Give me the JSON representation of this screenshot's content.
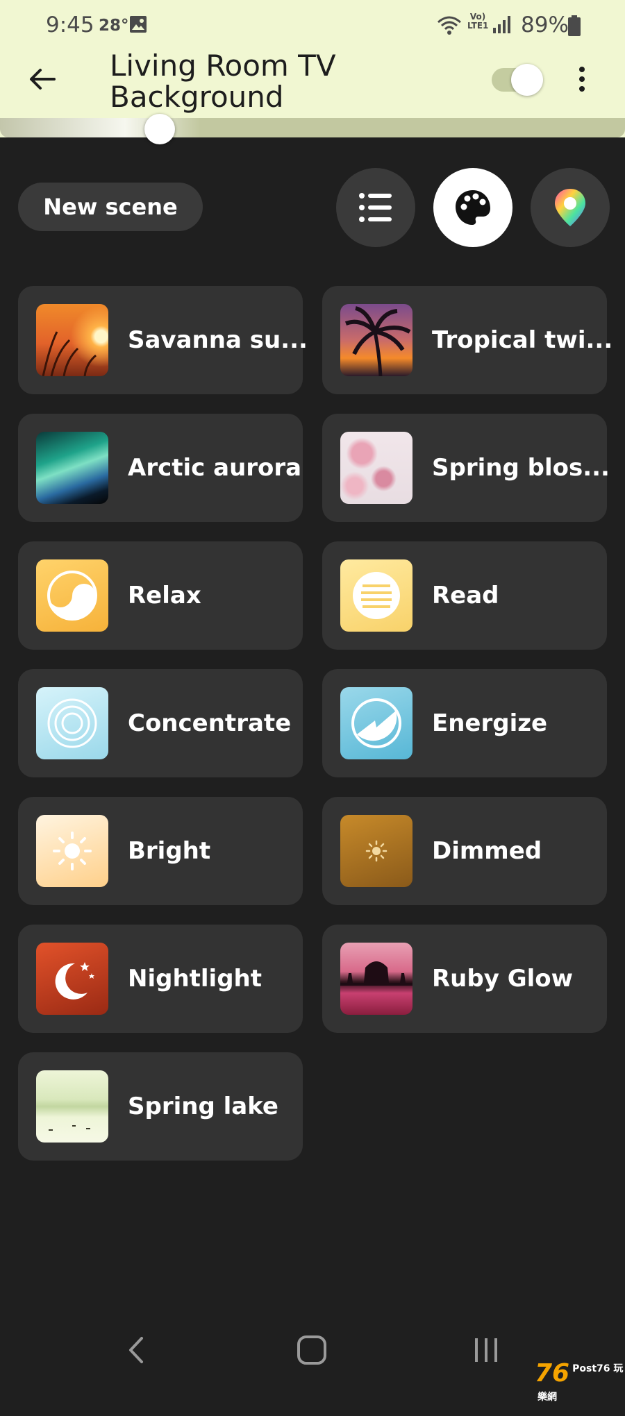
{
  "status_bar": {
    "time": "9:45",
    "temperature": "28°",
    "network_label": "Vo) LTE1",
    "battery": "89%"
  },
  "header": {
    "title": "Living Room TV Background",
    "power_on": true,
    "brightness_level": 0.26
  },
  "toolbar": {
    "new_scene_label": "New scene",
    "view_buttons": [
      {
        "name": "list",
        "icon": "list-icon",
        "selected": false
      },
      {
        "name": "palette",
        "icon": "palette-icon",
        "selected": true
      },
      {
        "name": "color-picker",
        "icon": "color-picker-icon",
        "selected": false
      }
    ]
  },
  "scenes": [
    {
      "label": "Savanna su..."
    },
    {
      "label": "Tropical twi..."
    },
    {
      "label": "Arctic aurora"
    },
    {
      "label": "Spring blos..."
    },
    {
      "label": "Relax"
    },
    {
      "label": "Read"
    },
    {
      "label": "Concentrate"
    },
    {
      "label": "Energize"
    },
    {
      "label": "Bright"
    },
    {
      "label": "Dimmed"
    },
    {
      "label": "Nightlight"
    },
    {
      "label": "Ruby Glow"
    },
    {
      "label": "Spring lake"
    }
  ],
  "watermark": {
    "main": "76",
    "sub": "Post76 玩樂網"
  },
  "colors": {
    "header_bg": "#f1f7d2",
    "page_bg": "#1f1f1f",
    "card_bg": "#333333"
  }
}
